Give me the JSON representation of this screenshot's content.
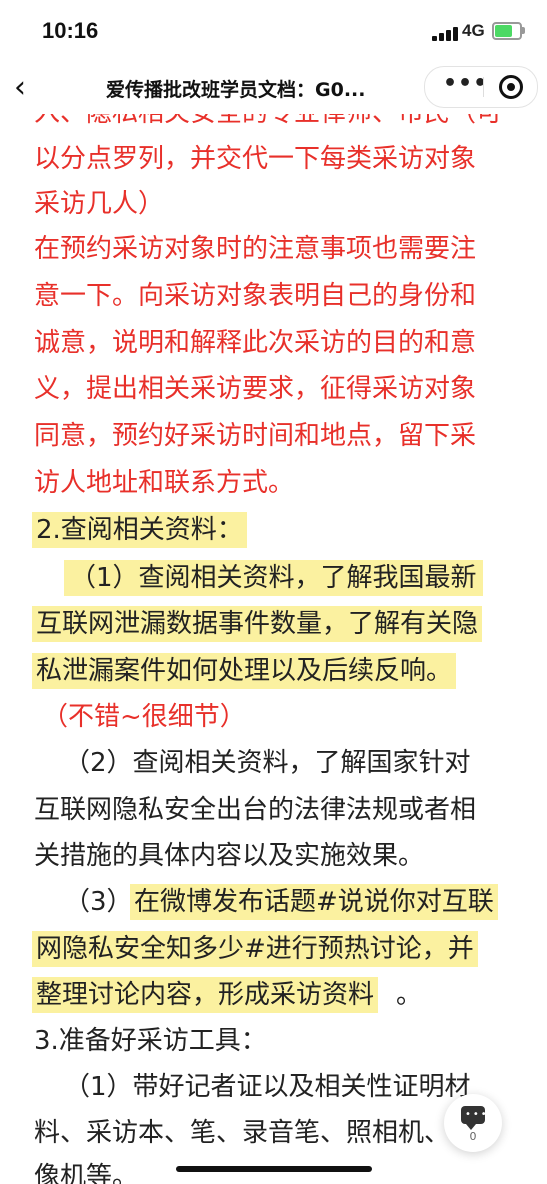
{
  "status_bar": {
    "time": "10:16",
    "network": "4G"
  },
  "nav": {
    "back_glyph": "‹",
    "title": "爱传播批改班学员文档：G0...",
    "more_glyph": "•••"
  },
  "doc": {
    "partial_top": "入、隐私相关安全的专业律师、市民（可",
    "red_lines": [
      "以分点罗列，并交代一下每类采访对象",
      "采访几人）",
      "在预约采访对象时的注意事项也需要注",
      "意一下。向采访对象表明自己的身份和",
      "诚意，说明和解释此次采访的目的和意",
      "义，提出相关采访要求，征得采访对象",
      "同意，预约好采访时间和地点，留下采",
      "访人地址和联系方式。"
    ],
    "section2_heading": "2.查阅相关资料：",
    "item1_lines": [
      "（1）查阅相关资料，了解我国最新",
      "互联网泄漏数据事件数量，了解有关隐",
      "私泄漏案件如何处理以及后续反响。"
    ],
    "comment1": "（不错~很细节）",
    "item2_lines": [
      "（2）查阅相关资料，了解国家针对",
      "互联网隐私安全出台的法律法规或者相",
      "关措施的具体内容以及实施效果。"
    ],
    "item3_prefix": "（3）",
    "item3_lines": [
      "在微博发布话题#说说你对互联",
      "网隐私安全知多少#进行预热讨论，并",
      "整理讨论内容，形成采访资料"
    ],
    "item3_end": "。",
    "section3_heading": "3.准备好采访工具：",
    "tools_lines": [
      "（1）带好记者证以及相关性证明材",
      "料、采访本、笔、录音笔、照相机、录",
      "像机等。"
    ]
  },
  "fab": {
    "count": "0",
    "icon": "comment-icon"
  },
  "colors": {
    "red": "#e8302a",
    "highlight": "#fbf1a0"
  }
}
